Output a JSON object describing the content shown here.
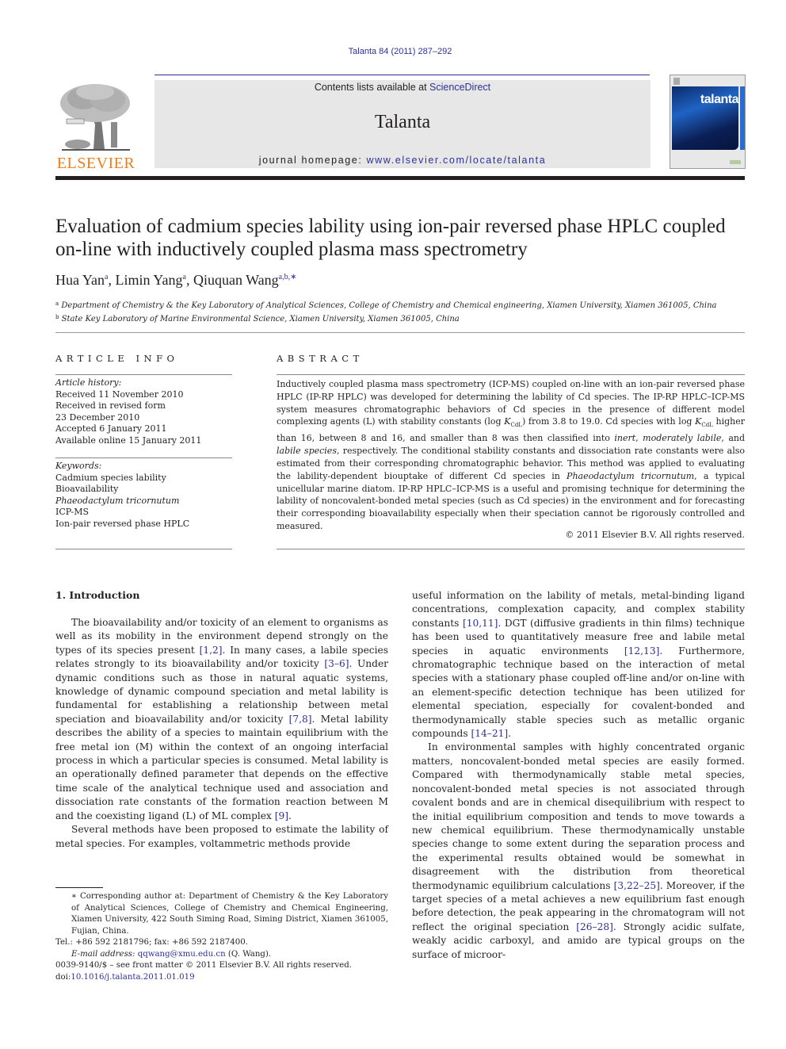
{
  "header": {
    "journal_ref": "Talanta 84 (2011) 287–292",
    "contents_prefix": "Contents lists available at ",
    "contents_link": "ScienceDirect",
    "journal_name": "Talanta",
    "homepage_prefix": "journal homepage: ",
    "homepage_url": "www.elsevier.com/locate/talanta",
    "publisher_logo": "ELSEVIER",
    "cover_title": "talanta",
    "colors": {
      "link": "#2e3192",
      "elsevier_orange": "#f07d1a",
      "masthead_gray": "#e7e7e8"
    }
  },
  "article": {
    "title": "Evaluation of cadmium species lability using ion-pair reversed phase HPLC coupled on-line with inductively coupled plasma mass spectrometry",
    "authors": [
      {
        "name": "Hua Yan",
        "sup": "a"
      },
      {
        "name": "Limin Yang",
        "sup": "a"
      },
      {
        "name": "Qiuquan Wang",
        "sup": "a,b,∗"
      }
    ],
    "affiliations": [
      {
        "key": "a",
        "text": "Department of Chemistry & the Key Laboratory of Analytical Sciences, College of Chemistry and Chemical engineering, Xiamen University, Xiamen 361005, China"
      },
      {
        "key": "b",
        "text": "State Key Laboratory of Marine Environmental Science, Xiamen University, Xiamen 361005, China"
      }
    ]
  },
  "article_info": {
    "heading": "ARTICLE INFO",
    "history_label": "Article history:",
    "history": [
      "Received 11 November 2010",
      "Received in revised form",
      "23 December 2010",
      "Accepted 6 January 2011",
      "Available online 15 January 2011"
    ],
    "keywords_label": "Keywords:",
    "keywords": [
      {
        "text": "Cadmium species lability",
        "italic": false
      },
      {
        "text": "Bioavailability",
        "italic": false
      },
      {
        "text": "Phaeodactylum tricornutum",
        "italic": true
      },
      {
        "text": "ICP-MS",
        "italic": false
      },
      {
        "text": "Ion-pair reversed phase HPLC",
        "italic": false
      }
    ]
  },
  "abstract": {
    "heading": "ABSTRACT",
    "p1": "Inductively coupled plasma mass spectrometry (ICP-MS) coupled on-line with an ion-pair reversed phase HPLC (IP-RP HPLC) was developed for determining the lability of Cd species. The IP-RP HPLC–ICP-MS system measures chromatographic behaviors of Cd species in the presence of different model complexing agents (L) with stability constants (log ",
    "k_symbol": "K",
    "k_sub": "CdL",
    "p2": ") from 3.8 to 19.0. Cd species with log ",
    "p3": " higher than 16, between 8 and 16, and smaller than 8 was then classified into ",
    "class_inert": "inert",
    "sep1": ", ",
    "class_moderate": "moderately labile",
    "sep2": ", and ",
    "class_labile": "labile species",
    "p4": ", respectively. The conditional stability constants and dissociation rate constants were also estimated from their corresponding chromatographic behavior. This method was applied to evaluating the lability-dependent biouptake of different Cd species in ",
    "organism": "Phaeodactylum tricornutum",
    "p5": ", a typical unicellular marine diatom. IP-RP HPLC–ICP-MS is a useful and promising technique for determining the lability of noncovalent-bonded metal species (such as Cd species) in the environment and for forecasting their corresponding bioavailability especially when their speciation cannot be rigorously controlled and measured.",
    "copyright": "© 2011 Elsevier B.V. All rights reserved."
  },
  "body": {
    "section_heading": "1.  Introduction",
    "left": {
      "p1": [
        {
          "t": "The bioavailability and/or toxicity of an element to organisms as well as its mobility in the environment depend strongly on the types of its species present "
        },
        {
          "ref": "[1,2]"
        },
        {
          "t": ". In many cases, a labile species relates strongly to its bioavailability and/or toxicity "
        },
        {
          "ref": "[3–6]"
        },
        {
          "t": ". Under dynamic conditions such as those in natural aquatic systems, knowledge of dynamic compound speciation and metal lability is fundamental for establishing a relationship between metal speciation and bioavailability and/or toxicity "
        },
        {
          "ref": "[7,8]"
        },
        {
          "t": ". Metal lability describes the ability of a species to maintain equilibrium with the free metal ion (M) within the context of an ongoing interfacial process in which a particular species is consumed. Metal lability is an operationally defined parameter that depends on the effective time scale of the analytical technique used and association and dissociation rate constants of the formation reaction between M and the coexisting ligand (L) of ML complex "
        },
        {
          "ref": "[9]"
        },
        {
          "t": "."
        }
      ],
      "p2": [
        {
          "t": "Several methods have been proposed to estimate the lability of metal species. For examples, voltammetric methods provide"
        }
      ]
    },
    "right": {
      "p1": [
        {
          "t": "useful information on the lability of metals, metal-binding ligand concentrations, complexation capacity, and complex stability constants "
        },
        {
          "ref": "[10,11]"
        },
        {
          "t": ". DGT (diffusive gradients in thin films) technique has been used to quantitatively measure free and labile metal species in aquatic environments "
        },
        {
          "ref": "[12,13]"
        },
        {
          "t": ". Furthermore, chromatographic technique based on the interaction of metal species with a stationary phase coupled off-line and/or on-line with an element-specific detection technique has been utilized for elemental speciation, especially for covalent-bonded and thermodynamically stable species such as metallic organic compounds "
        },
        {
          "ref": "[14–21]"
        },
        {
          "t": "."
        }
      ],
      "p2": [
        {
          "t": "In environmental samples with highly concentrated organic matters, noncovalent-bonded metal species are easily formed. Compared with thermodynamically stable metal species, noncovalent-bonded metal species is not associated through covalent bonds and are in chemical disequilibrium with respect to the initial equilibrium composition and tends to move towards a new chemical equilibrium. These thermodynamically unstable species change to some extent during the separation process and the experimental results obtained would be somewhat in disagreement with the distribution from theoretical thermodynamic equilibrium calculations "
        },
        {
          "ref": "[3,22–25]"
        },
        {
          "t": ". Moreover, if the target species of a metal achieves a new equilibrium fast enough before detection, the peak appearing in the chromatogram will not reflect the original speciation "
        },
        {
          "ref": "[26–28]"
        },
        {
          "t": ". Strongly acidic sulfate, weakly acidic carboxyl, and amido are typical groups on the surface of microor-"
        }
      ]
    }
  },
  "footnote": {
    "corresponding": "∗ Corresponding author at: Department of Chemistry & the Key Laboratory of Analytical Sciences, College of Chemistry and Chemical Engineering, Xiamen University, 422 South Siming Road, Siming District, Xiamen 361005, Fujian, China.",
    "tel": "Tel.: +86 592 2181796; fax: +86 592 2187400.",
    "email_label": "E-mail address:",
    "email": "qqwang@xmu.edu.cn",
    "email_owner": " (Q. Wang).",
    "front_matter": "0039-9140/$ – see front matter © 2011 Elsevier B.V. All rights reserved.",
    "doi_prefix": "doi:",
    "doi": "10.1016/j.talanta.2011.01.019"
  }
}
